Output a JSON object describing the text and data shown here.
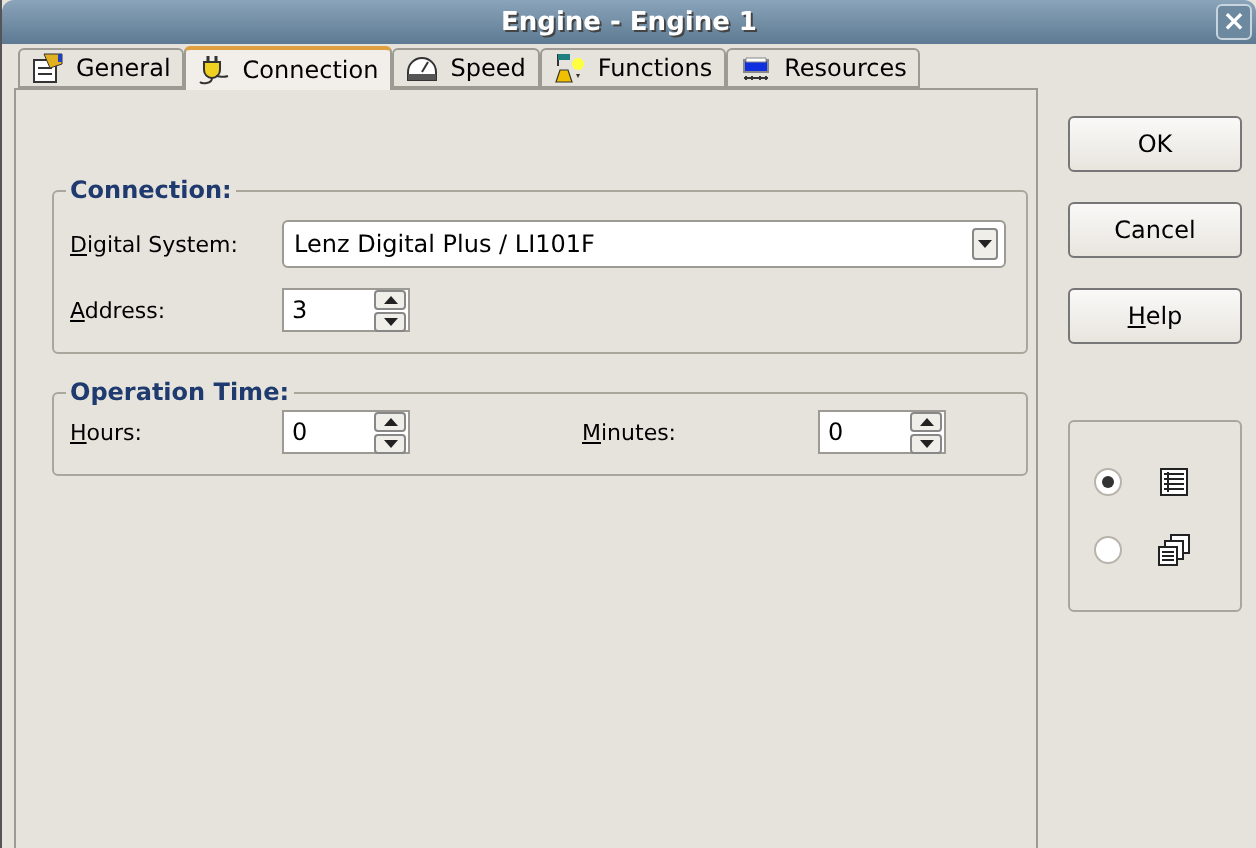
{
  "window": {
    "title": "Engine - Engine 1",
    "close": "×"
  },
  "tabs": [
    {
      "label": "General",
      "selected": false
    },
    {
      "label": "Connection",
      "selected": true
    },
    {
      "label": "Speed",
      "selected": false
    },
    {
      "label": "Functions",
      "selected": false
    },
    {
      "label": "Resources",
      "selected": false
    }
  ],
  "connection": {
    "title": "Connection:",
    "digital_system": {
      "label": "Digital System:",
      "value": "Lenz Digital Plus / LI101F"
    },
    "address": {
      "label": "Address:",
      "value": "3"
    }
  },
  "operation_time": {
    "title": "Operation Time:",
    "hours": {
      "label": "Hours:",
      "value": "0"
    },
    "minutes": {
      "label": "Minutes:",
      "value": "0"
    }
  },
  "buttons": [
    {
      "label": "OK",
      "mnemonic": false
    },
    {
      "label": "Cancel",
      "mnemonic": false
    },
    {
      "label": "Help",
      "mnemonic": true
    }
  ],
  "view_options": [
    {
      "selected": true
    },
    {
      "selected": false
    }
  ]
}
